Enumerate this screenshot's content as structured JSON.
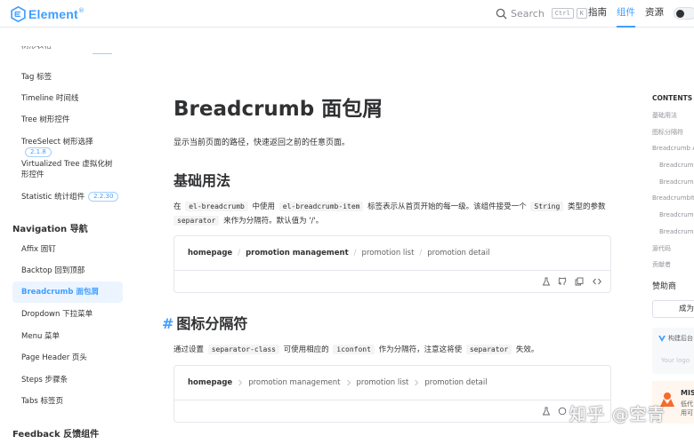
{
  "brand": {
    "name": "Element",
    "color": "#409eff"
  },
  "header": {
    "search_label": "Search",
    "shortcut_keys": [
      "Ctrl",
      "K"
    ],
    "nav": [
      "指南",
      "组件",
      "资源"
    ],
    "active_nav": "组件"
  },
  "sidebar": {
    "cut_item": "树形表格",
    "items_top": [
      {
        "label": "Tag 标签"
      },
      {
        "label": "Timeline 时间线"
      },
      {
        "label": "Tree 树形控件"
      },
      {
        "label": "TreeSelect 树形选择",
        "version": "2.1.8"
      },
      {
        "label": "Virtualized Tree 虚拟化树形控件"
      },
      {
        "label": "Statistic 统计组件",
        "version": "2.2.30"
      }
    ],
    "navigation_title": "Navigation 导航",
    "navigation_items": [
      {
        "label": "Affix 固钉"
      },
      {
        "label": "Backtop 回到顶部"
      },
      {
        "label": "Breadcrumb 面包屑",
        "active": true
      },
      {
        "label": "Dropdown 下拉菜单"
      },
      {
        "label": "Menu 菜单"
      },
      {
        "label": "Page Header 页头"
      },
      {
        "label": "Steps 步骤条"
      },
      {
        "label": "Tabs 标签页"
      }
    ],
    "feedback_title": "Feedback 反馈组件"
  },
  "main": {
    "title": "Breadcrumb 面包屑",
    "description": "显示当前页面的路径，快速返回之前的任意页面。",
    "section1": {
      "heading": "基础用法",
      "p1_a": "在",
      "p1_code1": "el-breadcrumb",
      "p1_b": "中使用",
      "p1_code2": "el-breadcrumb-item",
      "p1_c": "标签表示从首页开始的每一级。该组件接受一个",
      "p1_code3": "String",
      "p1_d": "类型的参数",
      "p1_code4": "separator",
      "p1_e": "来作为分隔符。默认值为 '/'。",
      "crumbs": [
        "homepage",
        "promotion management",
        "promotion list",
        "promotion detail"
      ],
      "separator": "/"
    },
    "section2": {
      "hash": "#",
      "heading": "图标分隔符",
      "p_a": "通过设置",
      "p_code1": "separator-class",
      "p_b": "可使用相应的",
      "p_code2": "iconfont",
      "p_c": "作为分隔符，注意这将使",
      "p_code3": "separator",
      "p_d": "失效。",
      "crumbs": [
        "homepage",
        "promotion management",
        "promotion list",
        "promotion detail"
      ]
    },
    "demo_actions": [
      "playground-icon",
      "github-icon",
      "copy-icon",
      "code-icon"
    ]
  },
  "toc": {
    "title": "CONTENTS",
    "items": [
      {
        "label": "基础用法",
        "indent": 0
      },
      {
        "label": "图标分隔符",
        "indent": 0
      },
      {
        "label": "Breadcrumb A",
        "indent": 0
      },
      {
        "label": "Breadcrumb",
        "indent": 1
      },
      {
        "label": "Breadcrumb",
        "indent": 1
      },
      {
        "label": "BreadcrumbIte",
        "indent": 0
      },
      {
        "label": "Breadcrumb",
        "indent": 1
      },
      {
        "label": "Breadcrumb",
        "indent": 1
      },
      {
        "label": "源代码",
        "indent": 0
      },
      {
        "label": "贡献者",
        "indent": 0
      }
    ],
    "sponsor_title": "赞助商",
    "sponsor_button": "成为",
    "ad1_text": "构建后台",
    "ad1_input": "Your logo",
    "ad2_name": "MISU",
    "ad2_lines": [
      "低代",
      "用可"
    ]
  },
  "watermark": "知乎 @空青"
}
